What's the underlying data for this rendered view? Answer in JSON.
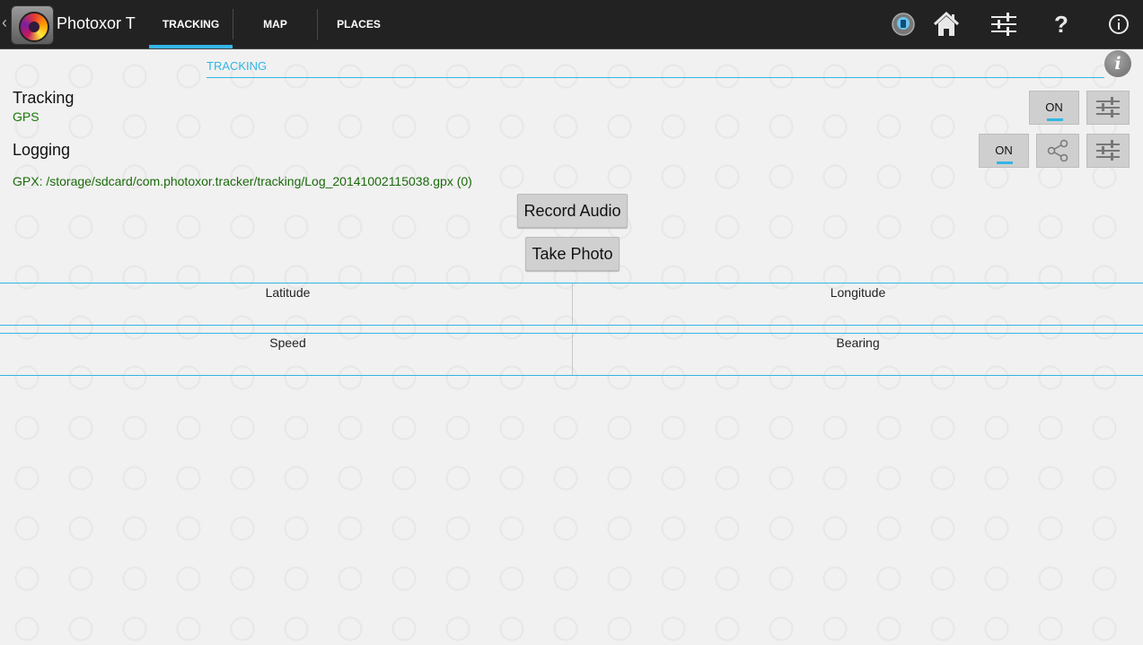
{
  "app": {
    "title": "Photoxor T"
  },
  "tabs": [
    {
      "label": "TRACKING",
      "active": true
    },
    {
      "label": "MAP",
      "active": false
    },
    {
      "label": "PLACES",
      "active": false
    }
  ],
  "action_icons": [
    "location-badge-icon",
    "home-icon",
    "sliders-icon",
    "help-icon",
    "info-icon"
  ],
  "section": {
    "title": "TRACKING"
  },
  "tracking": {
    "label": "Tracking",
    "source": "GPS",
    "toggle": "ON"
  },
  "logging": {
    "label": "Logging",
    "toggle": "ON",
    "file": "GPX: /storage/sdcard/com.photoxor.tracker/tracking/Log_20141002115038.gpx (0)"
  },
  "buttons": {
    "record_audio": "Record Audio",
    "take_photo": "Take Photo"
  },
  "fields": {
    "latitude": "Latitude",
    "longitude": "Longitude",
    "speed": "Speed",
    "bearing": "Bearing"
  },
  "colors": {
    "accent": "#33b5e5",
    "status_green": "#1a7a0a",
    "actionbar": "#222222"
  }
}
